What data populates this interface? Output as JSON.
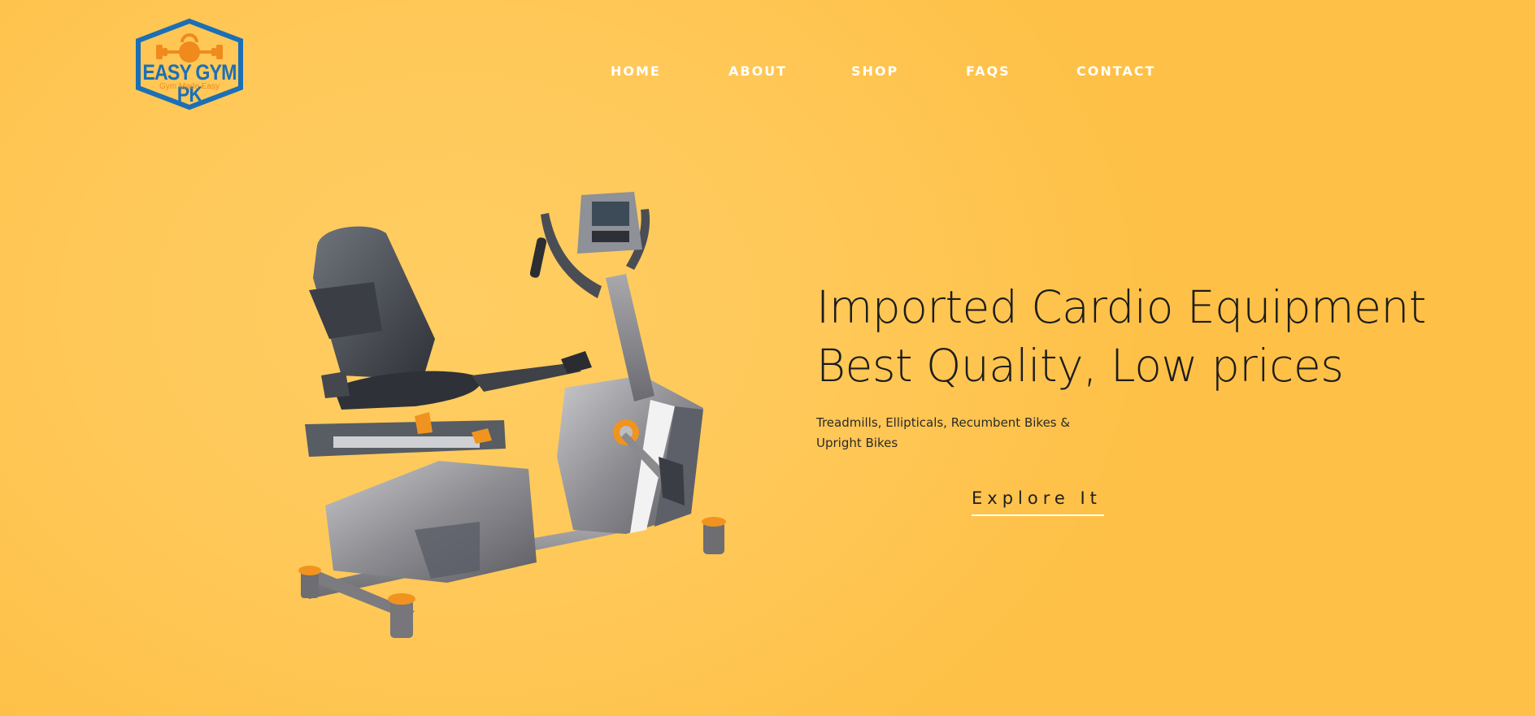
{
  "brand": {
    "name": "EASY GYM PK",
    "tagline": "Gym Made Easy",
    "primary_color": "#1b6fb6",
    "accent_color": "#f08a1c"
  },
  "nav": {
    "items": [
      {
        "label": "HOME"
      },
      {
        "label": "ABOUT"
      },
      {
        "label": "SHOP"
      },
      {
        "label": "FAQS"
      },
      {
        "label": "CONTACT"
      }
    ]
  },
  "hero": {
    "title_line1": "Imported Cardio Equipment",
    "title_line2": "Best Quality, Low prices",
    "subtitle": "Treadmills, Ellipticals, Recumbent Bikes & Upright Bikes",
    "cta_label": "Explore It",
    "image_subject": "recumbent-exercise-bike"
  },
  "colors": {
    "background": "#ffc95a",
    "nav_text": "#ffffff",
    "heading_text": "#1c1c1c"
  }
}
